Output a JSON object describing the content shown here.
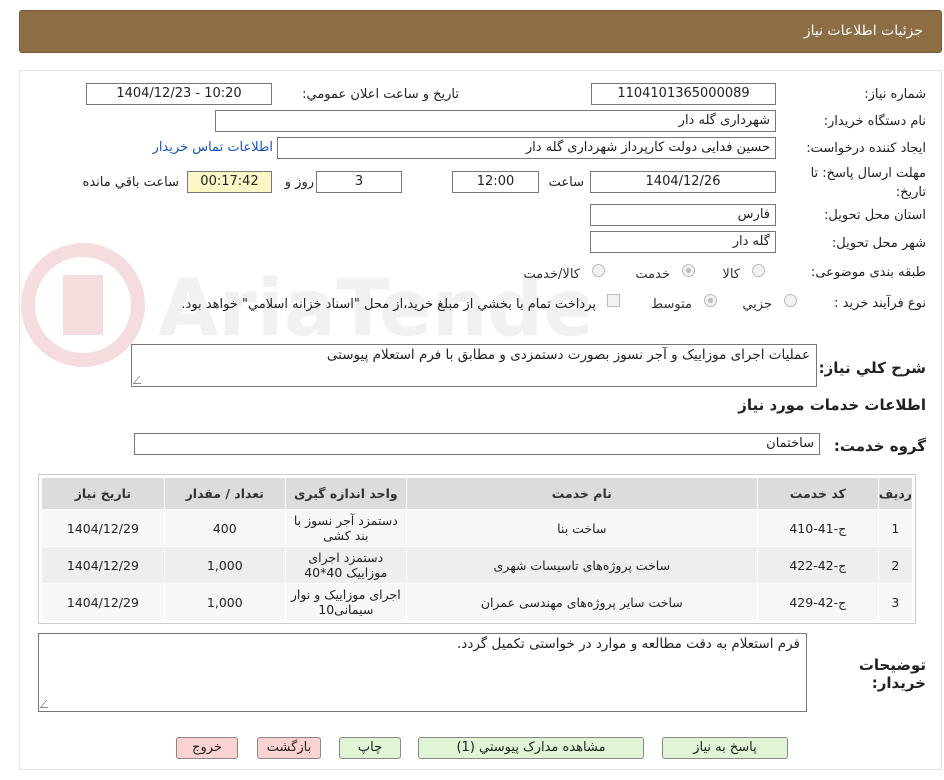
{
  "header": {
    "title": "جزئیات اطلاعات نیاز"
  },
  "form": {
    "need_number": {
      "label": "شماره نیاز:",
      "value": "1104101365000089"
    },
    "announce_datetime": {
      "label": "تاريخ و ساعت اعلان عمومي:",
      "value": "1404/12/23 - 10:20"
    },
    "buyer_org": {
      "label": "نام دستگاه خريدار:",
      "value": "شهرداری گله دار"
    },
    "requester": {
      "label": "ايجاد کننده درخواست:",
      "value": "حسین فدایی دولت کارپرداز شهرداری گله دار",
      "contact_link": "اطلاعات تماس خریدار"
    },
    "deadline": {
      "label_line1": "مهلت ارسال پاسخ: تا",
      "label_line2": "تاريخ:",
      "date": "1404/12/26",
      "time_label": "ساعت",
      "time": "12:00",
      "days": "3",
      "days_label": "روز و",
      "remaining": "00:17:42",
      "remaining_label": "ساعت باقي مانده"
    },
    "province": {
      "label": "استان محل تحويل:",
      "value": "فارس"
    },
    "city": {
      "label": "شهر محل تحويل:",
      "value": "گله دار"
    },
    "category": {
      "label": "طبقه بندی موضوعی:",
      "options": [
        "کالا",
        "خدمت",
        "کالا/خدمت"
      ],
      "selected": "خدمت"
    },
    "purchase_process": {
      "label": "نوع فرآيند خريد :",
      "options": [
        "جزيي",
        "متوسط"
      ],
      "selected": "متوسط",
      "note": "پرداخت تمام يا بخشي از مبلغ خريد،از محل \"اسناد خزانه اسلامي\" خواهد بود."
    },
    "description": {
      "label": "شرح کلي نياز:",
      "value": "عملیات اجرای موزاییک و آجر نسوز بصورت دستمزدی و مطابق با فرم استعلام پیوستی"
    }
  },
  "services": {
    "section_title": "اطلاعات خدمات مورد نياز",
    "group_label": "گروه خدمت:",
    "group_value": "ساختمان",
    "columns": [
      "ردیف",
      "کد خدمت",
      "نام خدمت",
      "واحد اندازه گیری",
      "تعداد / مقدار",
      "تاریخ نیاز"
    ],
    "rows": [
      [
        "1",
        "ج-41-410",
        "ساخت بنا",
        "دستمزد آجر نسوز با بند کشی",
        "400",
        "1404/12/29"
      ],
      [
        "2",
        "ج-42-422",
        "ساخت پروژه‌های تاسیسات شهری",
        "دستمزد اجرای موزاییک 40*40",
        "1,000",
        "1404/12/29"
      ],
      [
        "3",
        "ج-42-429",
        "ساخت سایر پروژه‌های مهندسی عمران",
        "اجرای موزاییک و نوار سیمانی10",
        "1,000",
        "1404/12/29"
      ]
    ]
  },
  "buyer_notes": {
    "label_line1": "توضيحات",
    "label_line2": "خريدار:",
    "value": "فرم استعلام به دقت مطالعه و موارد در خواستی تکمیل گردد."
  },
  "buttons": {
    "reply": "پاسخ به نياز",
    "attachments": "مشاهده مدارک پيوستي (1)",
    "print": "چاپ",
    "back": "بازگشت",
    "exit": "خروج"
  },
  "colors": {
    "header_bg": "#8c6d44",
    "link": "#1a55b5",
    "button_green": "#dff5d6",
    "button_pink": "#fbd2d2"
  },
  "watermark": "AriaTender.neT"
}
